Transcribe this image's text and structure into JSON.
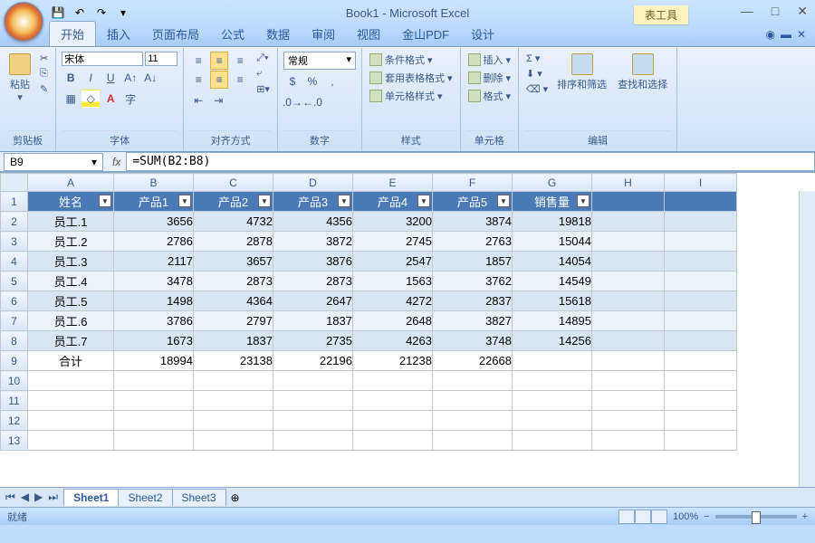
{
  "window": {
    "title": "Book1 - Microsoft Excel",
    "context_tab": "表工具"
  },
  "tabs": {
    "home": "开始",
    "insert": "插入",
    "layout": "页面布局",
    "formula": "公式",
    "data": "数据",
    "review": "审阅",
    "view": "视图",
    "pdf": "金山PDF",
    "design": "设计"
  },
  "groups": {
    "clipboard": "剪贴板",
    "font": "字体",
    "align": "对齐方式",
    "number": "数字",
    "styles": "样式",
    "cells": "单元格",
    "edit": "编辑"
  },
  "clipboard": {
    "paste": "粘贴"
  },
  "font": {
    "name": "宋体",
    "size": "11"
  },
  "number": {
    "format": "常规"
  },
  "styles": {
    "cond": "条件格式",
    "tblfmt": "套用表格格式",
    "cellfmt": "单元格样式"
  },
  "cells": {
    "insert": "插入",
    "delete": "删除",
    "format": "格式"
  },
  "edit": {
    "sort": "排序和筛选",
    "find": "查找和选择"
  },
  "namebox": "B9",
  "formula": "=SUM(B2:B8)",
  "cols": [
    "A",
    "B",
    "C",
    "D",
    "E",
    "F",
    "G",
    "H",
    "I"
  ],
  "hdr": [
    "姓名",
    "产品1",
    "产品2",
    "产品3",
    "产品4",
    "产品5",
    "销售量"
  ],
  "rows": [
    [
      "员工.1",
      "3656",
      "4732",
      "4356",
      "3200",
      "3874",
      "19818"
    ],
    [
      "员工.2",
      "2786",
      "2878",
      "3872",
      "2745",
      "2763",
      "15044"
    ],
    [
      "员工.3",
      "2117",
      "3657",
      "3876",
      "2547",
      "1857",
      "14054"
    ],
    [
      "员工.4",
      "3478",
      "2873",
      "2873",
      "1563",
      "3762",
      "14549"
    ],
    [
      "员工.5",
      "1498",
      "4364",
      "2647",
      "4272",
      "2837",
      "15618"
    ],
    [
      "员工.6",
      "3786",
      "2797",
      "1837",
      "2648",
      "3827",
      "14895"
    ],
    [
      "员工.7",
      "1673",
      "1837",
      "2735",
      "4263",
      "3748",
      "14256"
    ],
    [
      "合计",
      "18994",
      "23138",
      "22196",
      "21238",
      "22668",
      ""
    ]
  ],
  "sheets": {
    "s1": "Sheet1",
    "s2": "Sheet2",
    "s3": "Sheet3"
  },
  "status": {
    "ready": "就绪",
    "zoom": "100%"
  }
}
